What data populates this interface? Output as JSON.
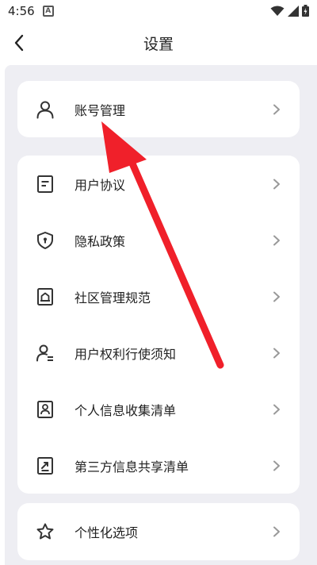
{
  "status": {
    "time": "4:56"
  },
  "header": {
    "title": "设置"
  },
  "groups": [
    {
      "items": [
        {
          "label": "账号管理",
          "icon": "person-icon"
        }
      ]
    },
    {
      "items": [
        {
          "label": "用户协议",
          "icon": "document-icon"
        },
        {
          "label": "隐私政策",
          "icon": "shield-icon"
        },
        {
          "label": "社区管理规范",
          "icon": "community-icon"
        },
        {
          "label": "用户权利行使须知",
          "icon": "user-rights-icon"
        },
        {
          "label": "个人信息收集清单",
          "icon": "id-card-icon"
        },
        {
          "label": "第三方信息共享清单",
          "icon": "share-icon"
        }
      ]
    },
    {
      "items": [
        {
          "label": "个性化选项",
          "icon": "star-icon"
        }
      ]
    }
  ],
  "colors": {
    "background": "#eeeef3",
    "card": "#ffffff",
    "arrow": "#f0202a",
    "icon": "#333333",
    "chevron": "#999999"
  }
}
